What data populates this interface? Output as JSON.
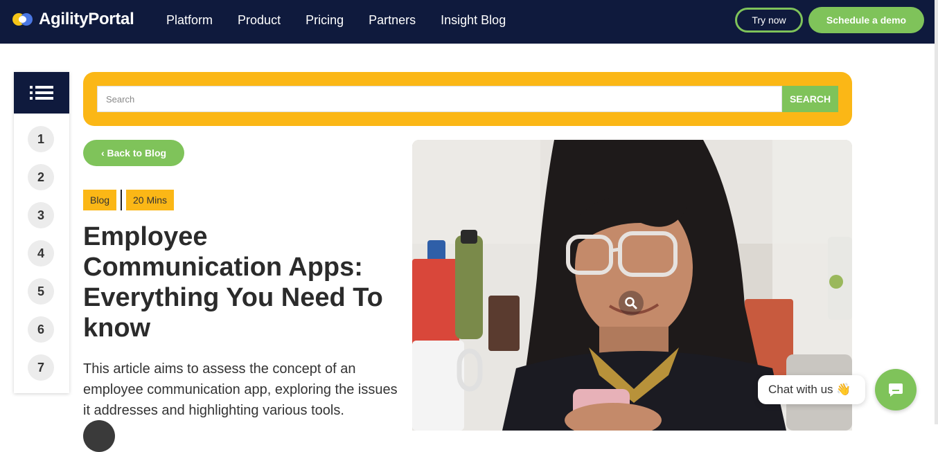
{
  "brand": {
    "name": "AgilityPortal",
    "accent": "#7fc35a",
    "yellow": "#fbb716",
    "navy": "#0f1a3d"
  },
  "nav": {
    "links": [
      "Platform",
      "Product",
      "Pricing",
      "Partners",
      "Insight Blog"
    ],
    "try_label": "Try now",
    "demo_label": "Schedule a demo"
  },
  "toc": {
    "icon": "list-icon",
    "items": [
      "1",
      "2",
      "3",
      "4",
      "5",
      "6",
      "7"
    ]
  },
  "search": {
    "placeholder": "Search",
    "value": "",
    "button_label": "SEARCH"
  },
  "article": {
    "back_label": "‹ Back to Blog",
    "tags": [
      "Blog",
      "20 Mins"
    ],
    "title": "Employee Communication Apps: Everything You Need To know",
    "excerpt": "This article aims to assess the concept of an employee communication app, exploring the issues it addresses and highlighting various tools."
  },
  "hero": {
    "icon": "zoom-icon"
  },
  "chat": {
    "label": "Chat with us",
    "emoji": "👋",
    "icon": "chat-icon"
  }
}
